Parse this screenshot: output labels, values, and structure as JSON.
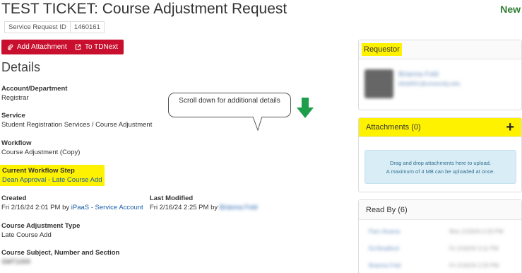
{
  "ticket": {
    "title": "TEST TICKET: Course Adjustment Request",
    "status": "New",
    "sr_label": "Service Request ID",
    "sr_value": "1460161"
  },
  "actions": {
    "add_attachment": "Add Attachment",
    "to_tdnext": "To TDNext"
  },
  "details": {
    "heading": "Details",
    "account_label": "Account/Department",
    "account_value": "Registrar",
    "service_label": "Service",
    "service_value": "Student Registration Services / Course Adjustment",
    "workflow_label": "Workflow",
    "workflow_value": "Course Adjustment (Copy)",
    "step_label": "Current Workflow Step",
    "step_value": "Dean Approval - Late Course Add",
    "created_label": "Created",
    "created_value": "Fri 2/16/24 2:01 PM by",
    "created_by": "iPaaS - Service Account",
    "modified_label": "Last Modified",
    "modified_value": "Fri 2/16/24 2:25 PM by",
    "modified_by": "Brianna Fold",
    "adj_type_label": "Course Adjustment Type",
    "adj_type_value": "Late Course Add",
    "subject_label": "Course Subject, Number and Section",
    "subject_value": "SMT1000"
  },
  "callout": {
    "text": "Scroll down for additional details"
  },
  "requestor": {
    "heading": "Requestor",
    "name": "Brianna Fold",
    "email": "bfold001@university.edu"
  },
  "attachments": {
    "heading": "Attachments (0)",
    "drop_line1": "Drag and drop attachments here to upload.",
    "drop_line2": "A maximum of 4 MB can be uploaded at once."
  },
  "read_by": {
    "heading": "Read By (6)",
    "rows": [
      {
        "name": "Pam Alvarez",
        "time": "Mon 2/19/24 2:33 PM"
      },
      {
        "name": "Ed Bradford",
        "time": "Fri 2/16/24 3:11 PM"
      },
      {
        "name": "Brianna Fold",
        "time": "Fri 2/16/24 2:25 PM"
      }
    ]
  },
  "colors": {
    "accent_red": "#c8102e",
    "highlight": "#fff200",
    "status_green": "#2e7d32",
    "arrow_green": "#1e9e4a"
  }
}
